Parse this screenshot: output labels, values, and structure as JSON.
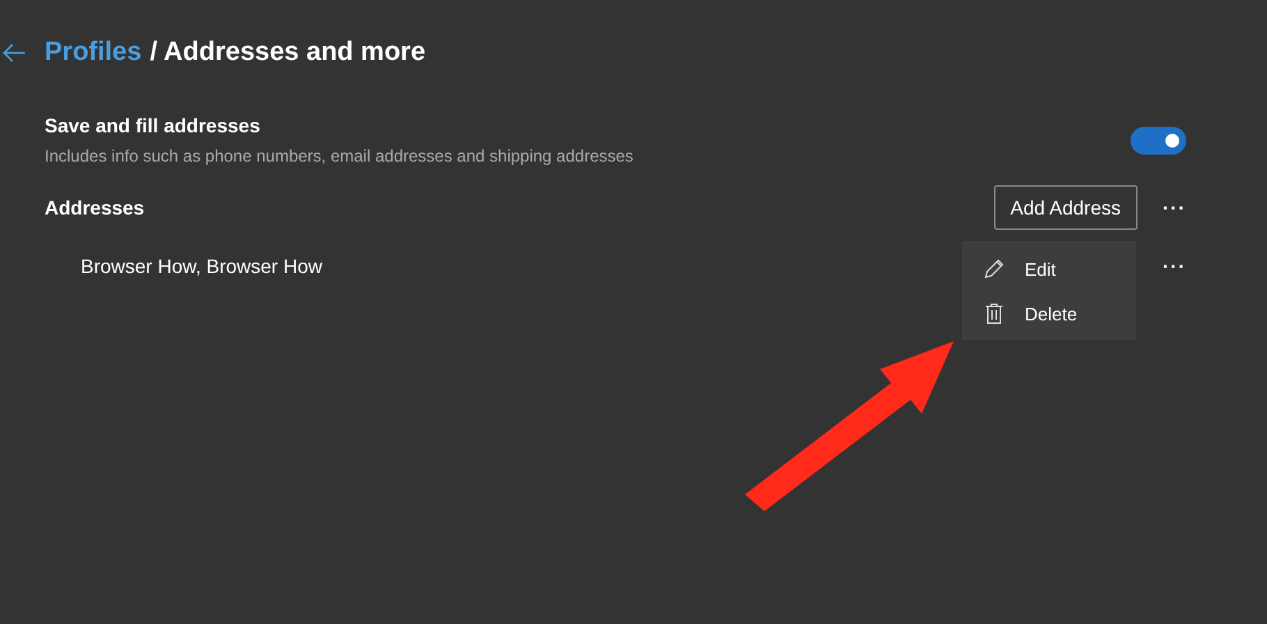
{
  "header": {
    "parent": "Profiles",
    "title": "/ Addresses and more"
  },
  "setting": {
    "title": "Save and fill addresses",
    "description": "Includes info such as phone numbers, email addresses and shipping addresses",
    "on": true
  },
  "addresses": {
    "title": "Addresses",
    "add_button": "Add Address",
    "more": "···",
    "items": [
      {
        "name": "Browser How, Browser How",
        "more": "···"
      }
    ]
  },
  "menu": {
    "items": [
      {
        "kind": "edit",
        "label": "Edit"
      },
      {
        "kind": "delete",
        "label": "Delete"
      }
    ]
  },
  "annotation_arrow": {
    "color": "#ff2a1a"
  }
}
